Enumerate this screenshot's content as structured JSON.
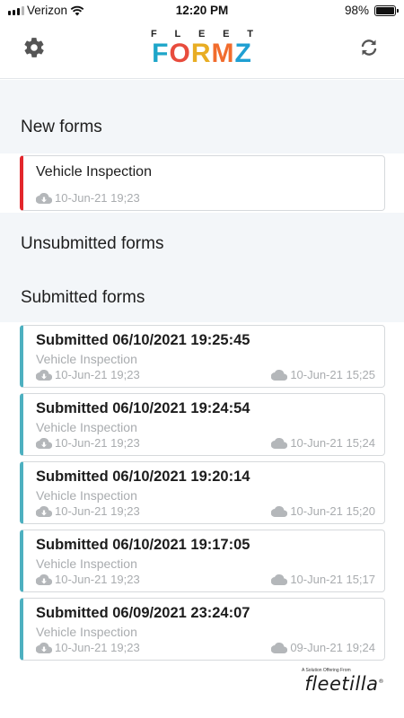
{
  "status_bar": {
    "carrier": "Verizon",
    "time": "12:20 PM",
    "battery": "98%",
    "battery_level": 0.98
  },
  "header": {
    "logo_top": [
      "F",
      "L",
      "E",
      "E",
      "T"
    ],
    "logo_bottom": [
      "F",
      "O",
      "R",
      "M",
      "Z"
    ],
    "logo_colors": [
      "#1ea6c9",
      "#e84c3d",
      "#e8ad23",
      "#f16c2d",
      "#1f9fd2"
    ],
    "settings_icon": "gear-icon",
    "refresh_icon": "refresh-icon"
  },
  "sections": {
    "new_forms": "New forms",
    "unsubmitted_forms": "Unsubmitted forms",
    "submitted_forms": "Submitted forms"
  },
  "new_forms": [
    {
      "title": "Vehicle Inspection",
      "created": "10-Jun-21 19;23"
    }
  ],
  "submitted_forms": [
    {
      "title": "Submitted 06/10/2021 19:25:45",
      "subtitle": "Vehicle Inspection",
      "created": "10-Jun-21 19;23",
      "submitted": "10-Jun-21 15;25"
    },
    {
      "title": "Submitted 06/10/2021 19:24:54",
      "subtitle": "Vehicle Inspection",
      "created": "10-Jun-21 19;23",
      "submitted": "10-Jun-21 15;24"
    },
    {
      "title": "Submitted 06/10/2021 19:20:14",
      "subtitle": "Vehicle Inspection",
      "created": "10-Jun-21 19;23",
      "submitted": "10-Jun-21 15;20"
    },
    {
      "title": "Submitted 06/10/2021 19:17:05",
      "subtitle": "Vehicle Inspection",
      "created": "10-Jun-21 19;23",
      "submitted": "10-Jun-21 15;17"
    },
    {
      "title": "Submitted 06/09/2021 23:24:07",
      "subtitle": "Vehicle Inspection",
      "created": "10-Jun-21 19;23",
      "submitted": "09-Jun-21 19;24"
    }
  ],
  "footer": {
    "tagline": "A Solution Offering From",
    "brand": "fleetilla",
    "reg": "®"
  },
  "colors": {
    "new_accent": "#e3262c",
    "submitted_accent": "#4db0c0",
    "section_bg": "#f3f6f9"
  }
}
